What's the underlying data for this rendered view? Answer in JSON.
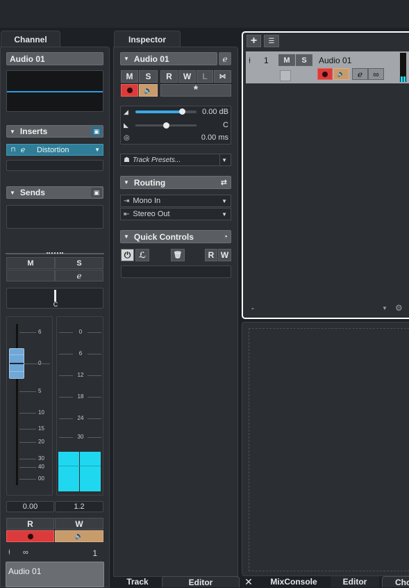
{
  "tabs": {
    "channel": "Channel",
    "inspector": "Inspector"
  },
  "channel": {
    "track_name": "Audio 01",
    "inserts": {
      "label": "Inserts",
      "plugin": "Distortion"
    },
    "sends": {
      "label": "Sends"
    },
    "mute": "M",
    "solo": "S",
    "pan_value": "C",
    "fader_scale": [
      "6",
      "0",
      "5",
      "10",
      "15",
      "20",
      "30",
      "40",
      "00"
    ],
    "meter_scale": [
      "0",
      "6",
      "12",
      "18",
      "24",
      "30"
    ],
    "volume_readout": "0.00",
    "meter_readout": "1.2",
    "read": "R",
    "write": "W",
    "channel_number": "1",
    "name_footer": "Audio 01"
  },
  "inspector": {
    "track_name": "Audio 01",
    "mute": "M",
    "solo": "S",
    "read": "R",
    "write": "W",
    "lock": "L",
    "volume": "0.00 dB",
    "pan": "C",
    "delay": "0.00 ms",
    "track_presets": "Track Presets...",
    "routing": {
      "label": "Routing",
      "input": "Mono In",
      "output": "Stereo Out"
    },
    "quick_controls": {
      "label": "Quick Controls",
      "read": "R",
      "write": "W"
    }
  },
  "tracklist": {
    "track_number": "1",
    "track_name": "Audio 01",
    "mute": "M",
    "solo": "S",
    "footer_value": "-"
  },
  "bottom_tabs": {
    "track": "Track",
    "editor": "Editor",
    "mixconsole": "MixConsole",
    "editor2": "Editor",
    "chords": "Cho"
  },
  "colors": {
    "accent": "#2bd4ef",
    "record": "#dc3b3b",
    "monitor": "#c89b6b",
    "selection": "#ffffff"
  }
}
